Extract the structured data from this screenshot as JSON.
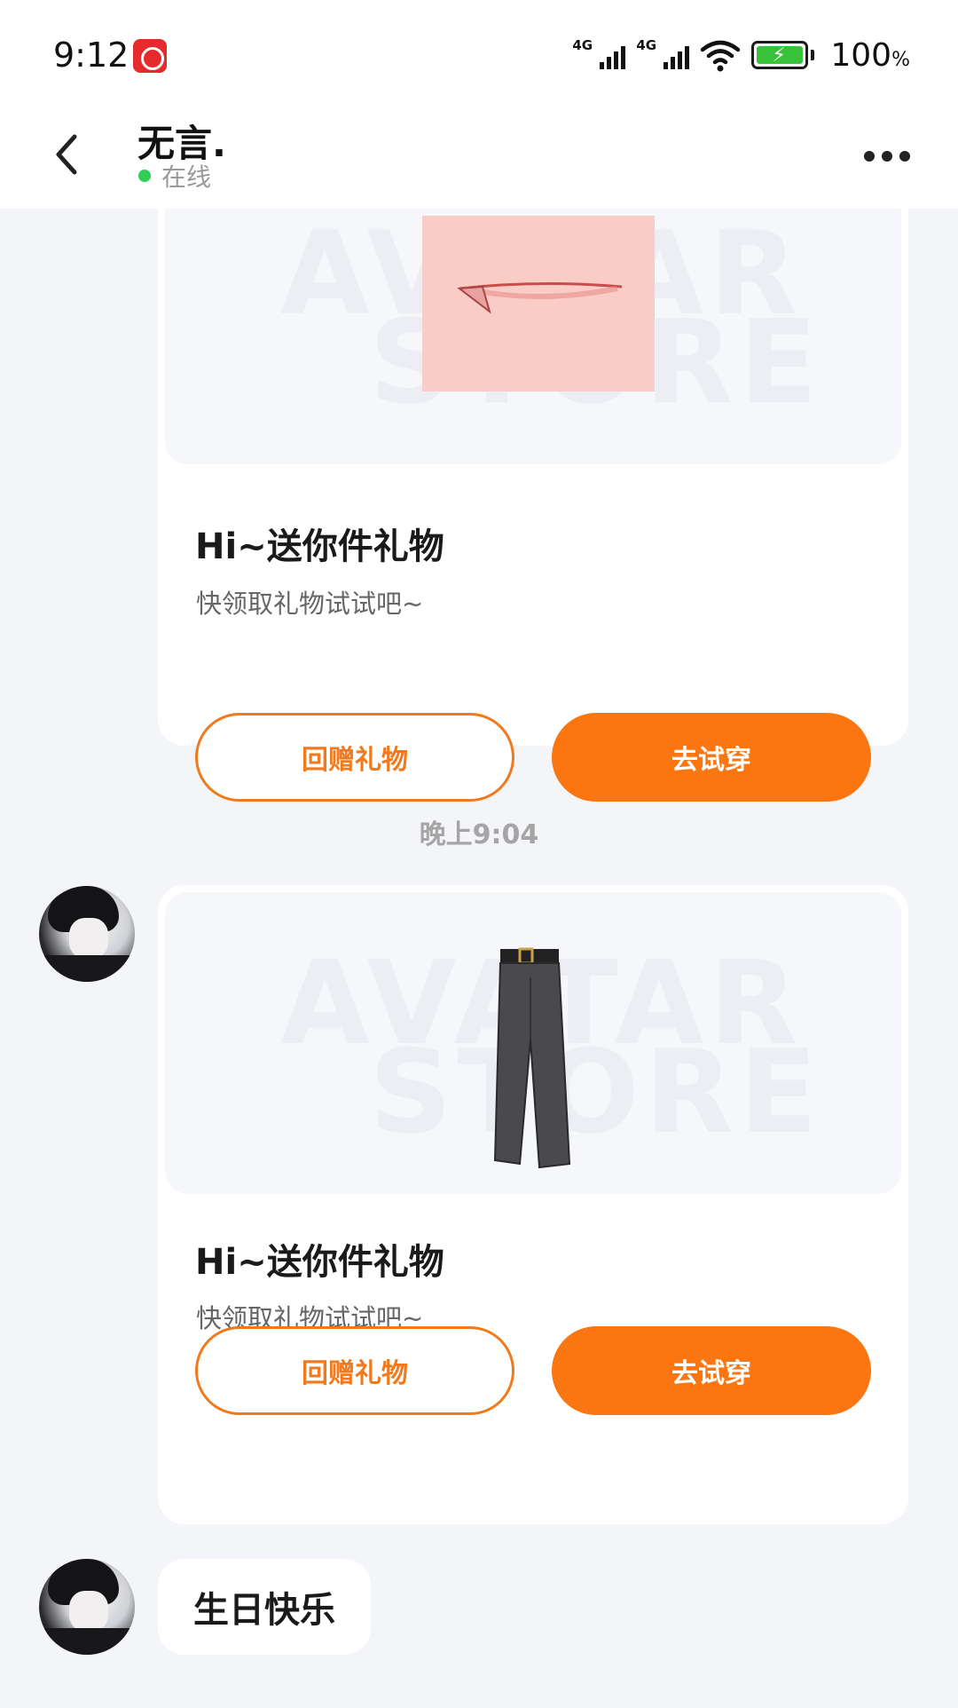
{
  "status_bar": {
    "time": "9:12",
    "signal_1": "4G",
    "signal_2": "4G",
    "battery_percent": "100",
    "battery_unit": "%"
  },
  "header": {
    "contact_name": "无言.",
    "status": "在线"
  },
  "messages": [
    {
      "type": "gift",
      "image": "lips-icon",
      "title": "Hi~送你件礼物",
      "subtitle": "快领取礼物试试吧~",
      "secondary_button": "回赠礼物",
      "primary_button": "去试穿"
    },
    {
      "type": "timestamp",
      "text": "晚上9:04"
    },
    {
      "type": "gift",
      "image": "pants-icon",
      "title": "Hi~送你件礼物",
      "subtitle": "快领取礼物试试吧~",
      "secondary_button": "回赠礼物",
      "primary_button": "去试穿"
    },
    {
      "type": "text",
      "text": "生日快乐"
    }
  ],
  "watermark": {
    "line1": "AVATAR",
    "line2": "STORE"
  },
  "colors": {
    "accent": "#fb7510",
    "online": "#2fcf57",
    "background": "#f3f5f9"
  }
}
